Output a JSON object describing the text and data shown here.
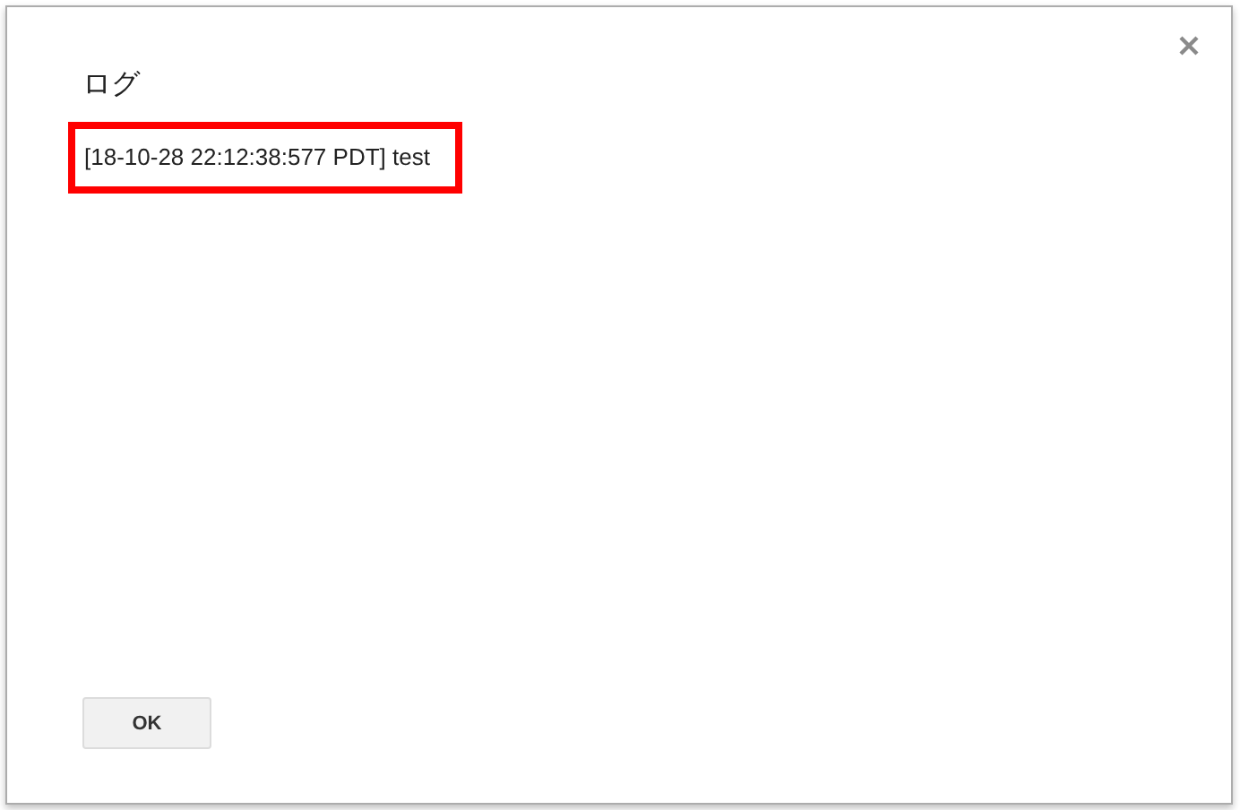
{
  "dialog": {
    "title": "ログ"
  },
  "log_entries": [
    {
      "text": "[18-10-28 22:12:38:577 PDT] test",
      "highlighted": true
    }
  ],
  "buttons": [
    {
      "label": "OK"
    }
  ]
}
